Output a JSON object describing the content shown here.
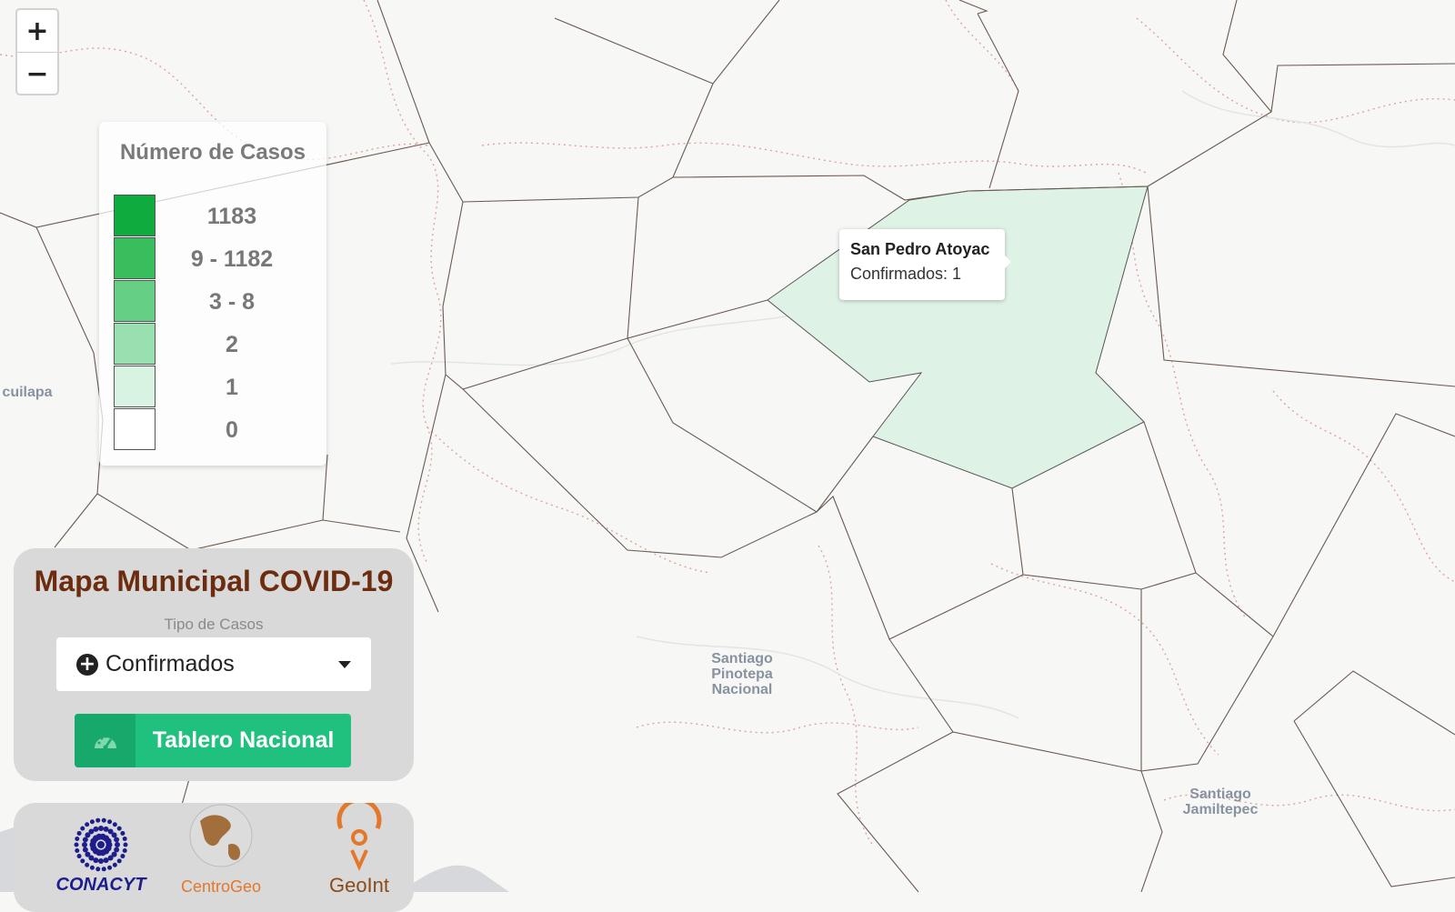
{
  "map": {
    "place_labels": [
      {
        "text": "cuilapa"
      },
      {
        "text": "Santiago\nPinotepa\nNacional"
      },
      {
        "text": "Santiago\nJamiltepec"
      }
    ],
    "highlight_color": "#dff2e6"
  },
  "zoom": {
    "in_label": "+",
    "out_label": "−"
  },
  "legend": {
    "title": "Número de Casos",
    "items": [
      {
        "label": "1183",
        "color": "#0fab3f"
      },
      {
        "label": "9 - 1182",
        "color": "#38be5c"
      },
      {
        "label": "3 - 8",
        "color": "#66cf86"
      },
      {
        "label": "2",
        "color": "#98e0b0"
      },
      {
        "label": "1",
        "color": "#d8f3e2"
      },
      {
        "label": "0",
        "color": "#ffffff"
      }
    ]
  },
  "tooltip": {
    "name": "San Pedro Atoyac",
    "value": "Confirmados: 1"
  },
  "panel": {
    "title": "Mapa Municipal COVID-19",
    "case_type_label": "Tipo de Casos",
    "case_type_value": "Confirmados",
    "button_label": "Tablero Nacional"
  },
  "logos": [
    {
      "name": "CONACYT",
      "color": "#1d1e8c"
    },
    {
      "name": "CentroGeo",
      "color": "#e3772a"
    },
    {
      "name": "GeoInt",
      "color": "#8a4b1b"
    }
  ]
}
